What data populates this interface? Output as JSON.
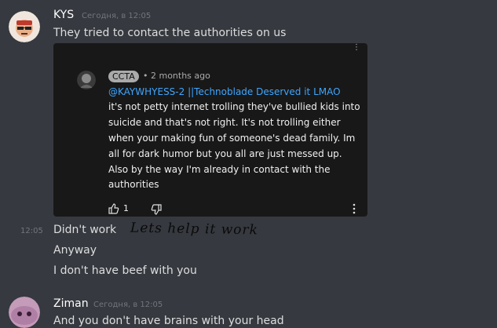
{
  "messages": [
    {
      "author": "KYS",
      "timestamp": "Сегодня, в 12:05",
      "text": "They tried to contact the authorities on us"
    },
    {
      "timestamp": "12:05",
      "text": "Didn't work"
    },
    {
      "text": "Anyway"
    },
    {
      "text": "I don't have beef with you"
    },
    {
      "author": "Ziman",
      "timestamp": "Сегодня, в 12:05",
      "text": "And you don't have brains with your head"
    }
  ],
  "embed": {
    "channel": "CCTA",
    "age": "• 2 months ago",
    "mention": "@KAYWHYESS-2 ||Technoblade Deserved it LMAO",
    "comment_lines": [
      "it's not petty internet trolling they've bullied kids into",
      "suicide and that's not right. It's not trolling either",
      "when your making fun of someone's dead family. Im",
      "all for dark humor but you all are just messed up.",
      "Also by the way I'm already in contact with the",
      "authorities"
    ],
    "likes": "1"
  },
  "handwriting": "Lets help it work",
  "colors": {
    "background": "#36393f",
    "embed_bg": "#181818",
    "mention": "#3ea6ff",
    "timestamp": "#72767d"
  }
}
